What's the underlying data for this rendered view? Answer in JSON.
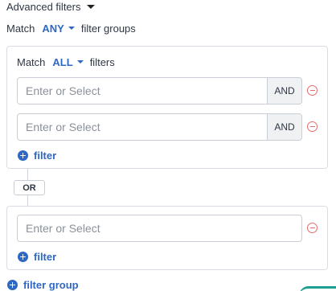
{
  "advanced_filters": {
    "label": "Advanced filters"
  },
  "outer_match": {
    "prefix": "Match",
    "value": "ANY",
    "suffix": "filter groups"
  },
  "groups": [
    {
      "match": {
        "prefix": "Match",
        "value": "ALL",
        "suffix": "filters"
      },
      "filters": [
        {
          "placeholder": "Enter or Select",
          "operator": "AND"
        },
        {
          "placeholder": "Enter or Select",
          "operator": "AND"
        }
      ],
      "add_filter_label": "filter"
    },
    {
      "filters": [
        {
          "placeholder": "Enter or Select"
        }
      ],
      "add_filter_label": "filter"
    }
  ],
  "group_connector": {
    "label": "OR"
  },
  "add_filter_group_label": "filter group",
  "colors": {
    "accent": "#2f67c4",
    "remove": "#e36d6d",
    "border": "#c9ced6",
    "operator_bg": "#f0f1f3"
  },
  "icons": {
    "advanced_toggle": "caret-down-icon",
    "match_dropdown": "chevron-down-icon",
    "remove": "minus-circle-icon",
    "add": "plus-circle-icon"
  }
}
